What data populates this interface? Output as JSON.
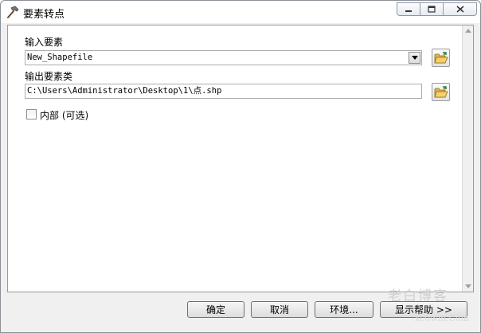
{
  "window": {
    "title": "要素转点",
    "icon": "hammer-icon",
    "minimize": "minimize-icon",
    "maximize": "maximize-icon",
    "close": "close-icon"
  },
  "form": {
    "input_label": "输入要素",
    "input_value": "New_Shapefile",
    "output_label": "输出要素类",
    "output_value": "C:\\Users\\Administrator\\Desktop\\1\\点.shp",
    "inside_label": "内部 (可选)",
    "inside_checked": false
  },
  "buttons": {
    "ok": "确定",
    "cancel": "取消",
    "env": "环境...",
    "help": "显示帮助 >>"
  },
  "watermark": {
    "line1": "老白博客",
    "line2": "xc0wm.Com"
  }
}
